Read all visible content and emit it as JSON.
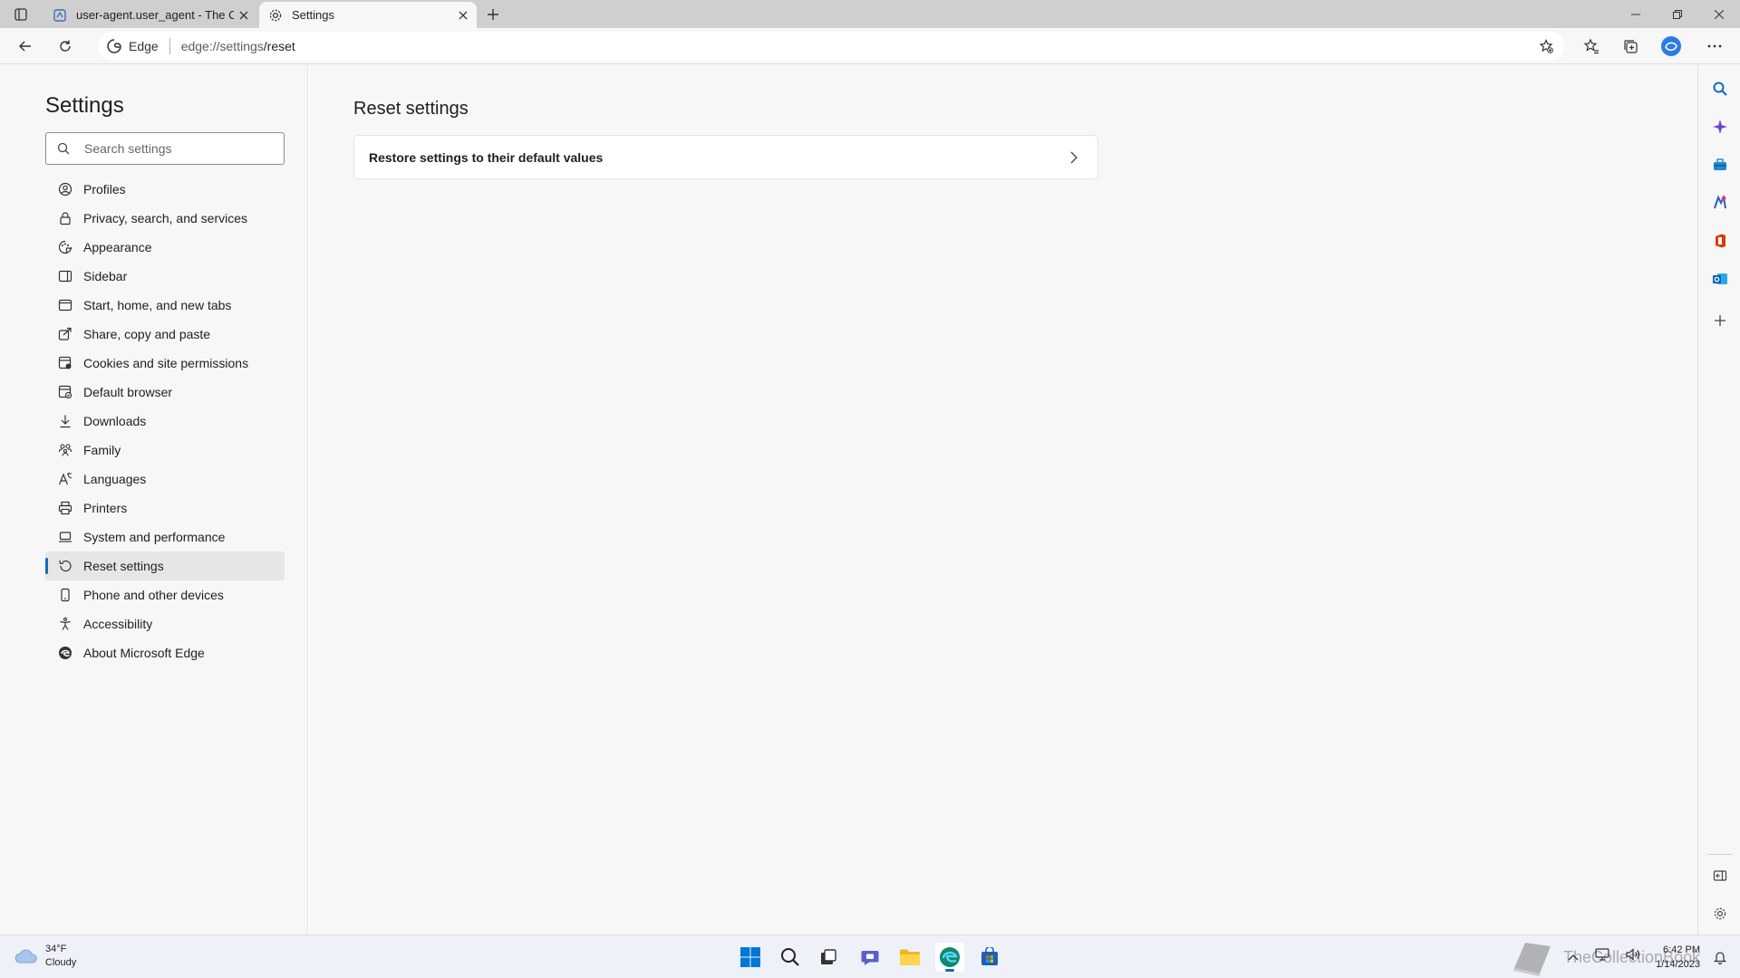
{
  "browser": {
    "tabs": [
      {
        "title": "user-agent.user_agent - The Coll",
        "favicon": "collection-book-icon",
        "active": false
      },
      {
        "title": "Settings",
        "favicon": "gear-icon",
        "active": true
      }
    ],
    "address": {
      "site_label": "Edge",
      "url_host": "edge://settings",
      "url_path": "/reset"
    }
  },
  "settings": {
    "title": "Settings",
    "search_placeholder": "Search settings",
    "nav": [
      {
        "label": "Profiles",
        "icon": "profile-icon"
      },
      {
        "label": "Privacy, search, and services",
        "icon": "lock-icon"
      },
      {
        "label": "Appearance",
        "icon": "appearance-icon"
      },
      {
        "label": "Sidebar",
        "icon": "sidebar-icon"
      },
      {
        "label": "Start, home, and new tabs",
        "icon": "home-tabs-icon"
      },
      {
        "label": "Share, copy and paste",
        "icon": "share-icon"
      },
      {
        "label": "Cookies and site permissions",
        "icon": "cookies-icon"
      },
      {
        "label": "Default browser",
        "icon": "default-browser-icon"
      },
      {
        "label": "Downloads",
        "icon": "download-icon"
      },
      {
        "label": "Family",
        "icon": "family-icon"
      },
      {
        "label": "Languages",
        "icon": "languages-icon"
      },
      {
        "label": "Printers",
        "icon": "printer-icon"
      },
      {
        "label": "System and performance",
        "icon": "laptop-icon"
      },
      {
        "label": "Reset settings",
        "icon": "reset-icon",
        "selected": true
      },
      {
        "label": "Phone and other devices",
        "icon": "phone-icon"
      },
      {
        "label": "Accessibility",
        "icon": "accessibility-icon"
      },
      {
        "label": "About Microsoft Edge",
        "icon": "edge-logo-icon"
      }
    ]
  },
  "content": {
    "title": "Reset settings",
    "card_label": "Restore settings to their default values"
  },
  "taskbar": {
    "temperature": "34°F",
    "condition": "Cloudy",
    "time": "6:42 PM",
    "date": "1/14/2023",
    "watermark": "TheCollectionBook"
  },
  "colors": {
    "accent": "#0f6cbd",
    "tab_strip": "#cfcfcf",
    "page_bg": "#f7f7f7"
  }
}
